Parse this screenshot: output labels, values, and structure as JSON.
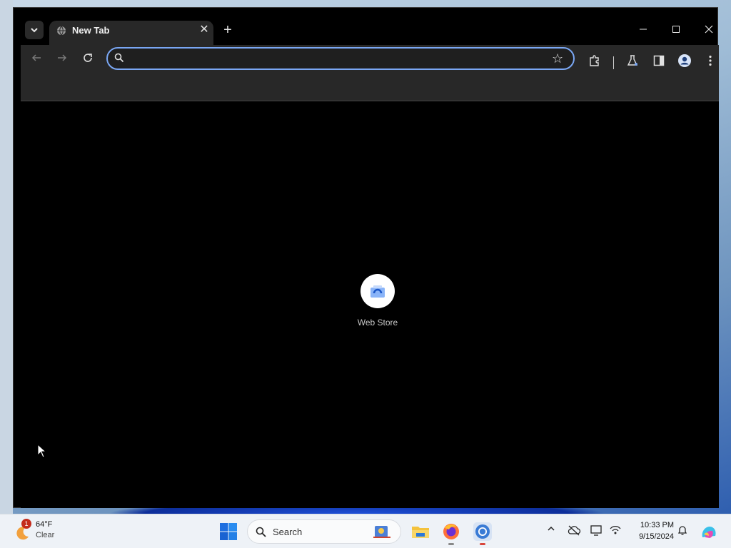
{
  "browser": {
    "tab": {
      "title": "New Tab"
    },
    "omnibox": {
      "value": "",
      "placeholder": ""
    },
    "shortcuts": [
      {
        "label": "Web Store"
      }
    ]
  },
  "taskbar": {
    "weather": {
      "temp": "64°F",
      "desc": "Clear",
      "badge": "1"
    },
    "search_label": "Search",
    "clock": {
      "time": "10:33 PM",
      "date": "9/15/2024"
    }
  },
  "colors": {
    "accent": "#7aa7f4",
    "tab_bg": "#282828",
    "content_bg": "#000000",
    "taskbar_bg": "#eef2f7"
  },
  "icons": {
    "tab_list": "chevron-down-icon",
    "tab_favicon": "globe-icon",
    "close": "close-icon",
    "new_tab": "plus-icon",
    "back": "arrow-left-icon",
    "forward": "arrow-right-icon",
    "reload": "reload-icon",
    "search": "search-icon",
    "star": "star-icon",
    "extensions": "puzzle-icon",
    "labs": "flask-icon",
    "side_panel": "side-panel-icon",
    "profile": "profile-icon",
    "menu": "kebab-menu-icon"
  }
}
